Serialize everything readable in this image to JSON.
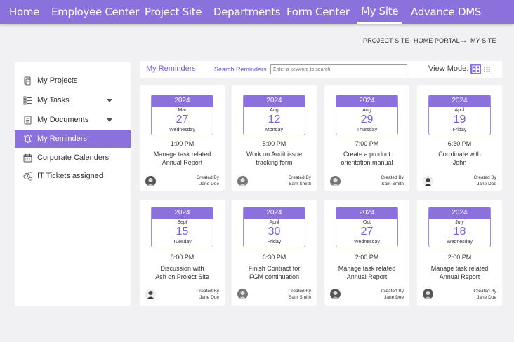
{
  "nav": {
    "items": [
      "Home",
      "Employee Center",
      "Project Site",
      "Departments",
      "Form Center",
      "My Site",
      "Advance DMS"
    ],
    "active": "My Site"
  },
  "breadcrumb": {
    "items": [
      "PROJECT SITE",
      "HOME PORTAL",
      "MY SITE"
    ]
  },
  "sidebar": {
    "items": [
      {
        "label": "My Projects",
        "icon": "projects-icon"
      },
      {
        "label": "My Tasks",
        "icon": "tasks-icon",
        "expandable": true
      },
      {
        "label": "My Documents",
        "icon": "documents-icon",
        "expandable": true
      },
      {
        "label": "My Reminders",
        "icon": "bell-icon",
        "active": true
      },
      {
        "label": "Corporate Calenders",
        "icon": "calendar-icon"
      },
      {
        "label": "IT Tickets assigned",
        "icon": "tickets-icon"
      }
    ]
  },
  "toolbar": {
    "title": "My Reminders",
    "search_label": "Search Reminders",
    "search_placeholder": "Enter a keyword to search",
    "view_mode_label": "View Mode:"
  },
  "colors": {
    "accent": "#8a71dc",
    "background": "#f1f1f4"
  },
  "reminders": [
    {
      "year": "2024",
      "month": "Mar",
      "day": "27",
      "weekday": "Wednesday",
      "time": "1:00 PM",
      "task_line1": "Manage task related",
      "task_line2": "Annual Report",
      "created_by_label": "Created By",
      "created_by": "Jane Doe"
    },
    {
      "year": "2024",
      "month": "Aug",
      "day": "12",
      "weekday": "Monday",
      "time": "5:00 PM",
      "task_line1": "Work on Audit issue",
      "task_line2": "tracking form",
      "created_by_label": "Created By",
      "created_by": "Sam Smith"
    },
    {
      "year": "2024",
      "month": "Aug",
      "day": "29",
      "weekday": "Thursday",
      "time": "7:00 PM",
      "task_line1": "Create a product",
      "task_line2": "orientation manual",
      "created_by_label": "Created By",
      "created_by": "Sam Smith"
    },
    {
      "year": "2024",
      "month": "April",
      "day": "19",
      "weekday": "Friday",
      "time": "6:30 PM",
      "task_line1": "Corrdinate with",
      "task_line2": "John",
      "created_by_label": "Created By",
      "created_by": "Jane Doe"
    },
    {
      "year": "2024",
      "month": "Sept",
      "day": "15",
      "weekday": "Tuesday",
      "time": "8:00 PM",
      "task_line1": "Discussion with",
      "task_line2": "Ash on Project Site",
      "created_by_label": "Created By",
      "created_by": "Jane Doe"
    },
    {
      "year": "2024",
      "month": "April",
      "day": "30",
      "weekday": "Friday",
      "time": "6:30 PM",
      "task_line1": "Finish Contract for",
      "task_line2": "FGM continuation",
      "created_by_label": "Created By",
      "created_by": "Sam Smith"
    },
    {
      "year": "2024",
      "month": "Oct",
      "day": "27",
      "weekday": "Wednesday",
      "time": "2:00 PM",
      "task_line1": "Manage task related",
      "task_line2": "Annual Report",
      "created_by_label": "Created By",
      "created_by": "Jane Doe"
    },
    {
      "year": "2024",
      "month": "July",
      "day": "18",
      "weekday": "Wednesday",
      "time": "2:00 PM",
      "task_line1": "Manage task related",
      "task_line2": "Annual Report",
      "created_by_label": "Created By",
      "created_by": "Jane Doe"
    }
  ]
}
